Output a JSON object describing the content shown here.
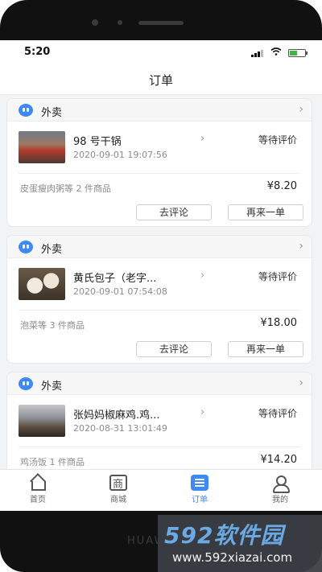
{
  "status_bar": {
    "time": "5:20"
  },
  "header": {
    "title": "订单"
  },
  "orders": [
    {
      "category": "外卖",
      "store_name": "98 号干锅",
      "order_time": "2020-09-01 19:07:56",
      "status": "等待评价",
      "goods_summary": "皮蛋瘦肉粥等 2 件商品",
      "price": "¥8.20",
      "review_label": "去评论",
      "reorder_label": "再来一单"
    },
    {
      "category": "外卖",
      "store_name": "黄氏包子（老字...",
      "order_time": "2020-09-01 07:54:08",
      "status": "等待评价",
      "goods_summary": "泡菜等 3 件商品",
      "price": "¥18.00",
      "review_label": "去评论",
      "reorder_label": "再来一单"
    },
    {
      "category": "外卖",
      "store_name": "张妈妈椒麻鸡.鸡...",
      "order_time": "2020-08-31 13:01:49",
      "status": "等待评价",
      "goods_summary": "鸡汤饭 1 件商品",
      "price": "¥14.20"
    }
  ],
  "tabbar": {
    "items": [
      {
        "label": "首页",
        "icon": "home-icon"
      },
      {
        "label": "商城",
        "icon": "mall-icon"
      },
      {
        "label": "订单",
        "icon": "order-list-icon",
        "active": true
      },
      {
        "label": "我的",
        "icon": "profile-icon"
      }
    ],
    "active_color": "#3d8af7"
  },
  "device": {
    "brand": "HUAWEI"
  },
  "watermark": {
    "title": "592软件园",
    "url": "www.592xiazai.com"
  }
}
